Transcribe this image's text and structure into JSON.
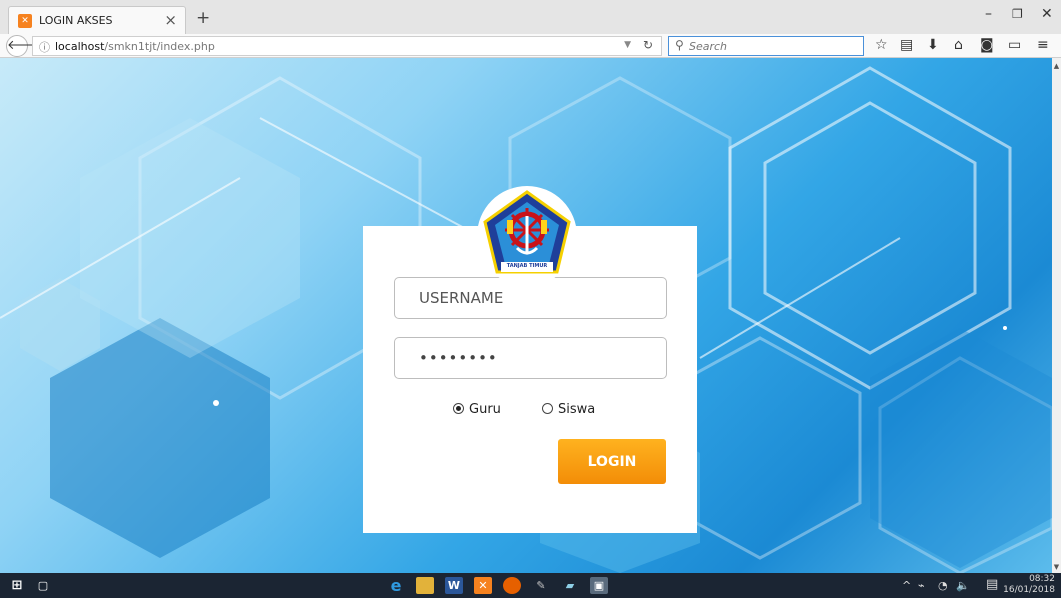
{
  "browser": {
    "tab_title": "LOGIN AKSES",
    "tab_icon": "xampp-icon",
    "new_tab": "+",
    "url_host": "localhost",
    "url_path": "/smkn1tjt/index.php",
    "search_placeholder": "Search"
  },
  "login": {
    "logo_caption": "TANJAB TIMUR",
    "username_placeholder": "USERNAME",
    "password_value": "••••••••",
    "role_options": [
      {
        "label": "Guru",
        "selected": true
      },
      {
        "label": "Siswa",
        "selected": false
      }
    ],
    "login_label": "LOGIN"
  },
  "taskbar": {
    "time": "08:32",
    "date": "16/01/2018"
  },
  "colors": {
    "accent_orange": "#f7a10f",
    "background_blue": "#33a6e6"
  }
}
